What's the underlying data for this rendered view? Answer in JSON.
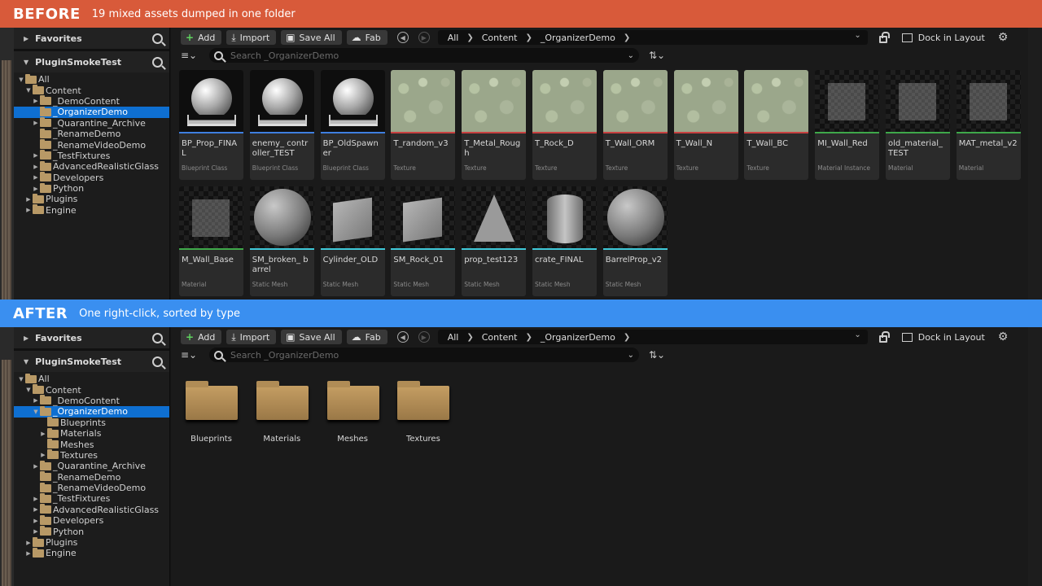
{
  "before_banner": {
    "title": "BEFORE",
    "subtitle": "19 mixed assets dumped in one folder",
    "color": "#d85a3a"
  },
  "after_banner": {
    "title": "AFTER",
    "subtitle": "One right-click, sorted by type",
    "color": "#3a8ff0"
  },
  "toolbar": {
    "add": "Add",
    "import": "Import",
    "save_all": "Save All",
    "fab": "Fab",
    "dock": "Dock in Layout"
  },
  "breadcrumb": [
    "All",
    "Content",
    "_OrganizerDemo"
  ],
  "search": {
    "placeholder": "Search _OrganizerDemo"
  },
  "sidebar": {
    "favorites": "Favorites",
    "project": "PluginSmokeTest"
  },
  "tree_before": [
    {
      "label": "All",
      "depth": 0,
      "arrow": "open"
    },
    {
      "label": "Content",
      "depth": 1,
      "arrow": "open"
    },
    {
      "label": "_DemoContent",
      "depth": 2,
      "arrow": "closed"
    },
    {
      "label": "_OrganizerDemo",
      "depth": 2,
      "arrow": "none",
      "selected": true
    },
    {
      "label": "_Quarantine_Archive",
      "depth": 2,
      "arrow": "closed"
    },
    {
      "label": "_RenameDemo",
      "depth": 2,
      "arrow": "none"
    },
    {
      "label": "_RenameVideoDemo",
      "depth": 2,
      "arrow": "none"
    },
    {
      "label": "_TestFixtures",
      "depth": 2,
      "arrow": "closed"
    },
    {
      "label": "AdvancedRealisticGlass",
      "depth": 2,
      "arrow": "closed"
    },
    {
      "label": "Developers",
      "depth": 2,
      "arrow": "closed"
    },
    {
      "label": "Python",
      "depth": 2,
      "arrow": "closed"
    },
    {
      "label": "Plugins",
      "depth": 1,
      "arrow": "closed"
    },
    {
      "label": "Engine",
      "depth": 1,
      "arrow": "closed"
    }
  ],
  "tree_after": [
    {
      "label": "All",
      "depth": 0,
      "arrow": "open"
    },
    {
      "label": "Content",
      "depth": 1,
      "arrow": "open"
    },
    {
      "label": "_DemoContent",
      "depth": 2,
      "arrow": "closed"
    },
    {
      "label": "_OrganizerDemo",
      "depth": 2,
      "arrow": "open",
      "selected": true
    },
    {
      "label": "Blueprints",
      "depth": 3,
      "arrow": "none"
    },
    {
      "label": "Materials",
      "depth": 3,
      "arrow": "closed"
    },
    {
      "label": "Meshes",
      "depth": 3,
      "arrow": "none"
    },
    {
      "label": "Textures",
      "depth": 3,
      "arrow": "closed"
    },
    {
      "label": "_Quarantine_Archive",
      "depth": 2,
      "arrow": "closed"
    },
    {
      "label": "_RenameDemo",
      "depth": 2,
      "arrow": "none"
    },
    {
      "label": "_RenameVideoDemo",
      "depth": 2,
      "arrow": "none"
    },
    {
      "label": "_TestFixtures",
      "depth": 2,
      "arrow": "closed"
    },
    {
      "label": "AdvancedRealisticGlass",
      "depth": 2,
      "arrow": "closed"
    },
    {
      "label": "Developers",
      "depth": 2,
      "arrow": "closed"
    },
    {
      "label": "Python",
      "depth": 2,
      "arrow": "closed"
    },
    {
      "label": "Plugins",
      "depth": 1,
      "arrow": "closed"
    },
    {
      "label": "Engine",
      "depth": 1,
      "arrow": "closed"
    }
  ],
  "assets": [
    {
      "name": "BP_Prop_FINAL",
      "type": "Blueprint Class",
      "kind": "bp",
      "color": "#3f7fe0"
    },
    {
      "name": "enemy_ controller_TEST",
      "type": "Blueprint Class",
      "kind": "bp",
      "color": "#3f7fe0"
    },
    {
      "name": "BP_OldSpawner",
      "type": "Blueprint Class",
      "kind": "bp",
      "color": "#3f7fe0"
    },
    {
      "name": "T_random_v3",
      "type": "Texture",
      "kind": "tex",
      "color": "#c84040"
    },
    {
      "name": "T_Metal_Rough",
      "type": "Texture",
      "kind": "tex",
      "color": "#c84040"
    },
    {
      "name": "T_Rock_D",
      "type": "Texture",
      "kind": "tex",
      "color": "#c84040"
    },
    {
      "name": "T_Wall_ORM",
      "type": "Texture",
      "kind": "tex",
      "color": "#c84040"
    },
    {
      "name": "T_Wall_N",
      "type": "Texture",
      "kind": "tex",
      "color": "#c84040"
    },
    {
      "name": "T_Wall_BC",
      "type": "Texture",
      "kind": "tex",
      "color": "#c84040"
    },
    {
      "name": "MI_Wall_Red",
      "type": "Material Instance",
      "kind": "mat",
      "color": "#3fa84a"
    },
    {
      "name": "old_material_ TEST",
      "type": "Material",
      "kind": "mat",
      "color": "#3fa84a"
    },
    {
      "name": "MAT_metal_v2",
      "type": "Material",
      "kind": "mat",
      "color": "#3fa84a"
    },
    {
      "name": "M_Wall_Base",
      "type": "Material",
      "kind": "mat",
      "color": "#3fa84a"
    },
    {
      "name": "SM_broken_ barrel",
      "type": "Static Mesh",
      "kind": "sphere",
      "color": "#3fc8d8"
    },
    {
      "name": "Cylinder_OLD",
      "type": "Static Mesh",
      "kind": "cube",
      "color": "#3fc8d8"
    },
    {
      "name": "SM_Rock_01",
      "type": "Static Mesh",
      "kind": "cube",
      "color": "#3fc8d8"
    },
    {
      "name": "prop_test123",
      "type": "Static Mesh",
      "kind": "cone",
      "color": "#3fc8d8"
    },
    {
      "name": "crate_FINAL",
      "type": "Static Mesh",
      "kind": "cyl",
      "color": "#3fc8d8"
    },
    {
      "name": "BarrelProp_v2",
      "type": "Static Mesh",
      "kind": "sphere",
      "color": "#3fc8d8"
    }
  ],
  "folders": [
    "Blueprints",
    "Materials",
    "Meshes",
    "Textures"
  ]
}
